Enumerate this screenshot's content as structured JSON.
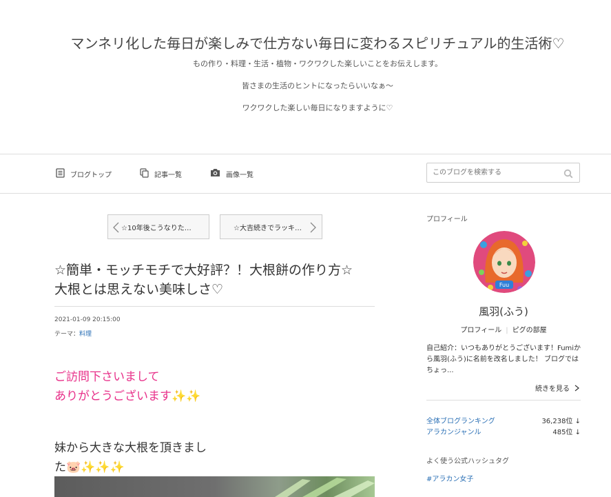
{
  "header": {
    "title": "マンネリ化した毎日が楽しみで仕方ない毎日に変わるスピリチュアル的生活術♡",
    "desc1": "もの作り・料理・生活・植物・ワクワクした楽しいことをお伝えします。",
    "desc2": "皆さまの生活のヒントになったらいいなぁ〜",
    "desc3": "ワクワクした楽しい毎日になりますように♡"
  },
  "nav": {
    "items": [
      {
        "label": "ブログトップ",
        "icon": "document-icon"
      },
      {
        "label": "記事一覧",
        "icon": "copy-icon"
      },
      {
        "label": "画像一覧",
        "icon": "camera-icon"
      }
    ],
    "search_placeholder": "このブログを検索する"
  },
  "pager": {
    "prev": "☆10年後こうなりた…",
    "next": "☆大吉続きでラッキ…"
  },
  "article": {
    "title_line1": "☆簡単・モッチモチで大好評？！大根餅の作り方☆",
    "title_line2": "大根とは思えない美味しさ♡",
    "date": "2021-01-09 20:15:00",
    "theme_label": "テーマ：",
    "theme": "料理",
    "pink_line1": "ご訪問下さいまして",
    "pink_line2": "ありがとうございます✨✨",
    "body_line1": "妹から大きな大根を頂きまし",
    "body_line2": "た🐷✨✨✨"
  },
  "sidebar": {
    "profile_heading": "プロフィール",
    "name": "風羽(ふう)",
    "link_profile": "プロフィール",
    "link_room": "ピグの部屋",
    "intro": "自己紹介：いつもありがとうございます！Fumiから風羽(ふう)に名前を改名しました！ ブログでは ちょっ...",
    "read_more": "続きを見る",
    "ranking": [
      {
        "label": "全体ブログランキング",
        "value": "36,238位 ↓"
      },
      {
        "label": "アラカンジャンル",
        "value": "485位 ↓"
      }
    ],
    "hashtag_heading": "よく使う公式ハッシュタグ",
    "hashtag": "#アラカン女子"
  },
  "colors": {
    "accent_pink": "#e8318a",
    "link_blue": "#2a6fb5"
  }
}
